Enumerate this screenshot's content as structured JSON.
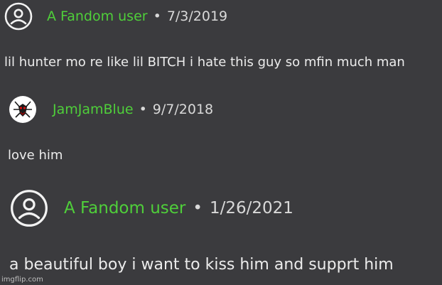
{
  "comments": [
    {
      "username": "A Fandom user",
      "separator": "•",
      "date": "7/3/2019",
      "text": "lil hunter mo re like lil BITCH i hate this guy so mfin much man",
      "avatar_icon": "default-user-icon"
    },
    {
      "username": "JamJamBlue",
      "separator": "•",
      "date": "9/7/2018",
      "text": "love him",
      "avatar_icon": "custom-avatar-image"
    },
    {
      "username": "A Fandom user",
      "separator": "•",
      "date": "1/26/2021",
      "text": "a beautiful boy i want to kiss him and supprt him",
      "avatar_icon": "default-user-icon"
    }
  ],
  "watermark": "imgflip.com",
  "colors": {
    "background": "#3b3b3e",
    "username": "#4fcf3a",
    "text": "#ececec",
    "date": "#d9d9d9"
  }
}
